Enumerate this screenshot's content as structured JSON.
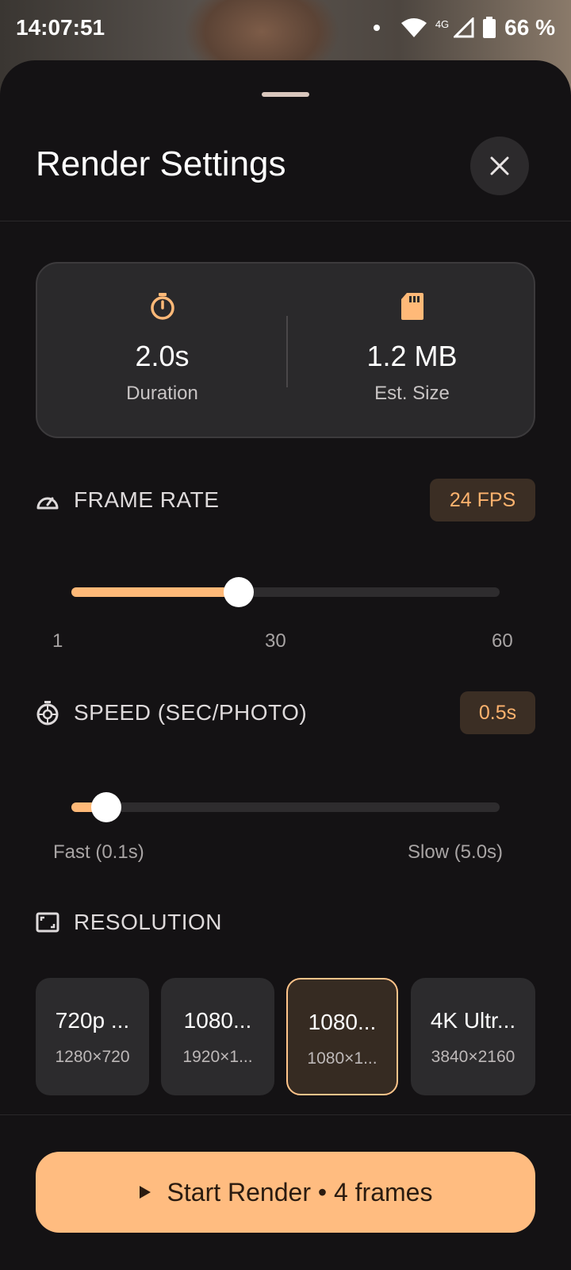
{
  "status_bar": {
    "time": "14:07:51",
    "network": "4G",
    "battery": "66 %"
  },
  "sheet": {
    "title": "Render Settings"
  },
  "summary": {
    "duration_value": "2.0s",
    "duration_label": "Duration",
    "size_value": "1.2 MB",
    "size_label": "Est. Size"
  },
  "frame_rate": {
    "label": "FRAME RATE",
    "badge": "24 FPS",
    "value": 24,
    "min": 1,
    "max": 60,
    "ticks": [
      "1",
      "30",
      "60"
    ]
  },
  "speed": {
    "label": "SPEED (SEC/PHOTO)",
    "badge": "0.5s",
    "value": 0.5,
    "min": 0.1,
    "max": 5.0,
    "min_label": "Fast (0.1s)",
    "max_label": "Slow (5.0s)"
  },
  "resolution": {
    "label": "RESOLUTION",
    "options": [
      {
        "name": "720p ...",
        "dims": "1280×720",
        "selected": false
      },
      {
        "name": "1080...",
        "dims": "1920×1...",
        "selected": false
      },
      {
        "name": "1080...",
        "dims": "1080×1...",
        "selected": true
      },
      {
        "name": "4K Ultr...",
        "dims": "3840×2160",
        "selected": false
      }
    ]
  },
  "start_button": {
    "label": "Start Render • 4 frames"
  },
  "colors": {
    "accent": "#ffb978",
    "sheet_bg": "#141214"
  }
}
